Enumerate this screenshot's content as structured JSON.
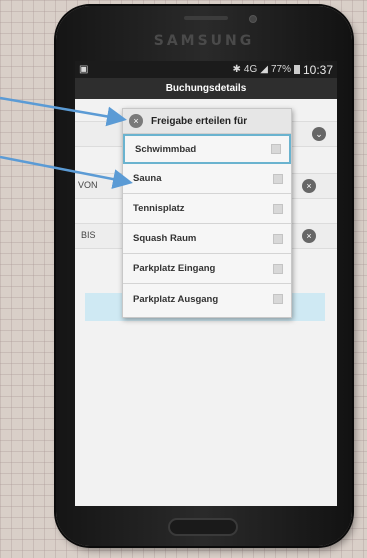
{
  "phone": {
    "brand": "SAMSUNG"
  },
  "statusbar": {
    "left_icon": "picture-icon",
    "signal_text": "4G",
    "battery": "77%",
    "time": "10:37",
    "colors": {
      "bar": "#1b1b1b",
      "text": "#d8d8d8"
    }
  },
  "app": {
    "title": "Buchungsdetails",
    "fields": [
      {
        "label": "VON"
      },
      {
        "label": "BIS"
      }
    ]
  },
  "dialog": {
    "title": "Freigabe erteilen für",
    "options": [
      {
        "label": "Schwimmbad",
        "checked": false
      },
      {
        "label": "Sauna",
        "checked": false
      },
      {
        "label": "Tennisplatz",
        "checked": false
      },
      {
        "label": "Squash Raum",
        "checked": false
      },
      {
        "label": "Parkplatz Eingang",
        "checked": false
      },
      {
        "label": "Parkplatz Ausgang",
        "checked": false
      }
    ],
    "colors": {
      "highlight": "#6ab3cf",
      "arrow": "#5b9bd5"
    }
  }
}
